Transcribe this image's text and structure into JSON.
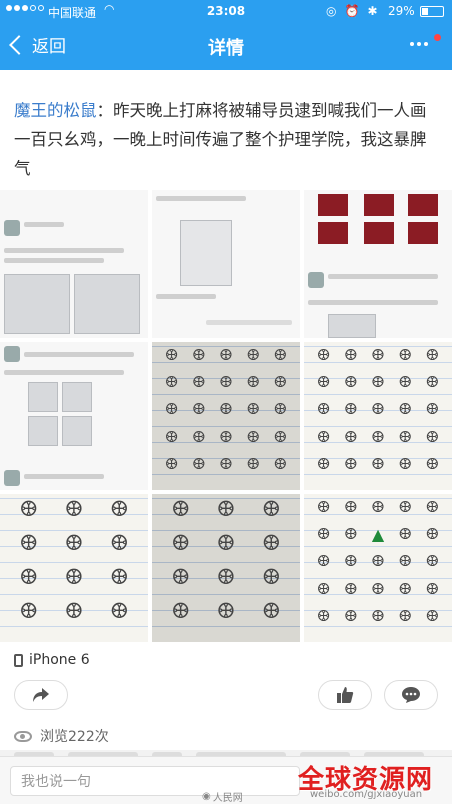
{
  "status": {
    "carrier": "中国联通",
    "time": "23:08",
    "battery": "29%",
    "battery_fraction": 0.29
  },
  "nav": {
    "back_label": "返回",
    "title": "详情"
  },
  "post": {
    "author": "魔王的松鼠",
    "separator": "：",
    "text": "昨天晚上打麻将被辅导员逮到喊我们一人画一百只幺鸡，一晚上时间传遍了整个护理学院，我这暴脾气",
    "device": "iPhone 6",
    "views": "浏览222次",
    "images": [
      {
        "kind": "screenshot"
      },
      {
        "kind": "screenshot"
      },
      {
        "kind": "screenshot"
      },
      {
        "kind": "screenshot"
      },
      {
        "kind": "drawing"
      },
      {
        "kind": "drawing"
      },
      {
        "kind": "drawing"
      },
      {
        "kind": "drawing"
      },
      {
        "kind": "drawing"
      }
    ]
  },
  "icons": {
    "back": "chevron-left-icon",
    "more": "more-dots-icon",
    "device": "phone-icon",
    "share": "share-arrow-icon",
    "like": "thumbs-up-icon",
    "comment": "comment-bubble-icon",
    "views": "eye-icon"
  },
  "colors": {
    "nav_bg": "#2b9ff0",
    "author": "#3b7dcc",
    "badge": "#f44444",
    "watermark": "#e02020"
  },
  "bottom": {
    "comment_placeholder": "我也说一句",
    "watermark_people": "人民网",
    "watermark_weibo": "weibo.com/gjxiaoyuan",
    "watermark_site": "全球资源网"
  }
}
